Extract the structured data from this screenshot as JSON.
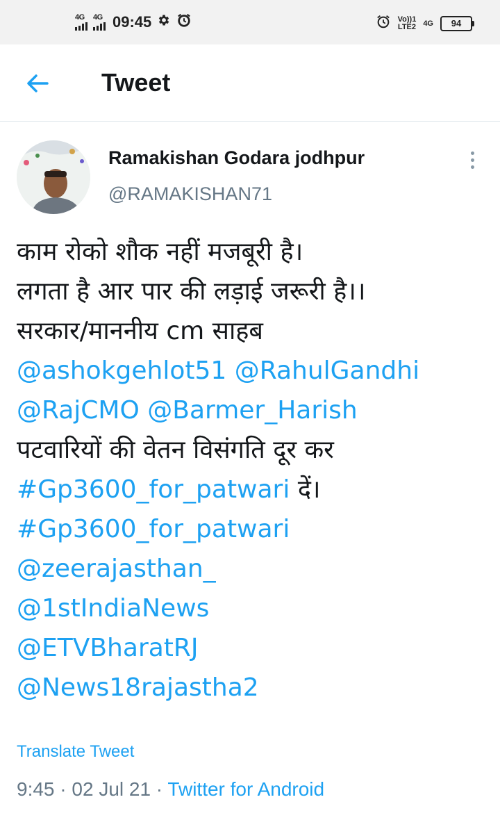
{
  "status_bar": {
    "sim1_network": "4G",
    "sim2_network": "4G",
    "time": "09:45",
    "volte_top": "Vo))1",
    "volte_bottom": "LTE2",
    "network_right": "4G",
    "battery": "94",
    "icons": [
      "signal-icon",
      "signal-icon",
      "settings-gear-icon",
      "alarm-icon",
      "alarm-icon",
      "battery-icon"
    ]
  },
  "header": {
    "title": "Tweet",
    "back_icon": "back-arrow-icon"
  },
  "author": {
    "name": "Ramakishan Godara jodhpur",
    "handle": "@RAMAKISHAN71",
    "more_icon": "more-vertical-icon"
  },
  "tweet": {
    "lines": [
      [
        {
          "text": "काम रोको शौक नहीं मजबूरी है।",
          "type": "text"
        }
      ],
      [
        {
          "text": "लगता है आर पार की लड़ाई जरूरी है।।",
          "type": "text"
        }
      ],
      [
        {
          "text": "सरकार/माननीय cm साहब",
          "type": "text"
        }
      ],
      [
        {
          "text": "@ashokgehlot51",
          "type": "link"
        },
        {
          "text": " ",
          "type": "text"
        },
        {
          "text": "@RahulGandhi",
          "type": "link"
        }
      ],
      [
        {
          "text": "@RajCMO",
          "type": "link"
        },
        {
          "text": " ",
          "type": "text"
        },
        {
          "text": "@Barmer_Harish",
          "type": "link"
        }
      ],
      [
        {
          "text": "पटवारियों की वेतन विसंगति दूर कर",
          "type": "text"
        }
      ],
      [
        {
          "text": "#Gp3600_for_patwari",
          "type": "link"
        },
        {
          "text": " दें।",
          "type": "text"
        }
      ],
      [
        {
          "text": "#Gp3600_for_patwari",
          "type": "link"
        }
      ],
      [
        {
          "text": "@zeerajasthan_",
          "type": "link"
        }
      ],
      [
        {
          "text": "@1stIndiaNews",
          "type": "link"
        }
      ],
      [
        {
          "text": "@ETVBharatRJ",
          "type": "link"
        }
      ],
      [
        {
          "text": "@News18rajastha2",
          "type": "link"
        }
      ]
    ],
    "translate_label": "Translate Tweet",
    "time": "9:45",
    "separator": " · ",
    "date": "02 Jul 21",
    "source": "Twitter for Android"
  },
  "colors": {
    "link": "#1da1f2",
    "secondary_text": "#657786",
    "primary_text": "#14171a",
    "status_bar_bg": "#f2f2f2"
  }
}
